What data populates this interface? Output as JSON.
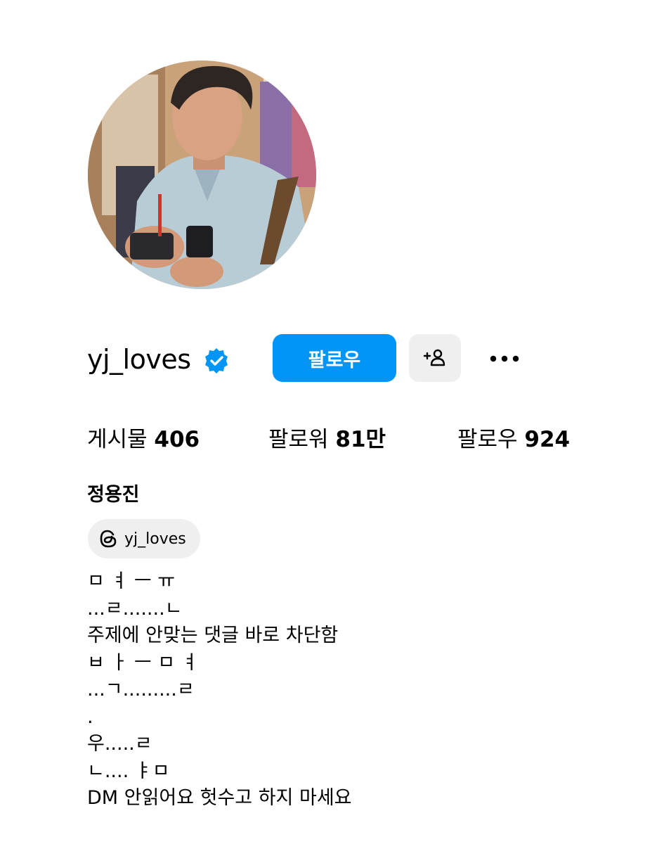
{
  "profile": {
    "username": "yj_loves",
    "verified_icon": "verified-badge-icon",
    "follow_label": "팔로우",
    "suggest_icon": "add-person-icon",
    "more_icon": "more-options-icon",
    "full_name": "정용진"
  },
  "stats": {
    "posts_label": "게시물",
    "posts_value": "406",
    "followers_label": "팔로워",
    "followers_value": "81만",
    "following_label": "팔로우",
    "following_value": "924"
  },
  "threads": {
    "icon": "threads-icon",
    "label": "yj_loves"
  },
  "bio": {
    "lines": [
      "ㅁ ㅕ ㅡ ㅠ",
      "...ㄹ.......ㄴ",
      "주제에 안맞는 댓글 바로 차단함",
      "ㅂ ㅏ ㅡ ㅁ ㅕ",
      "...ㄱ.........ㄹ",
      ".",
      "우.....ㄹ",
      "ㄴ.... ㅑㅁ",
      "DM 안읽어요 헛수고 하지 마세요"
    ]
  },
  "colors": {
    "accent": "#0095f6",
    "secondary_button": "#efefef",
    "text": "#000000"
  }
}
